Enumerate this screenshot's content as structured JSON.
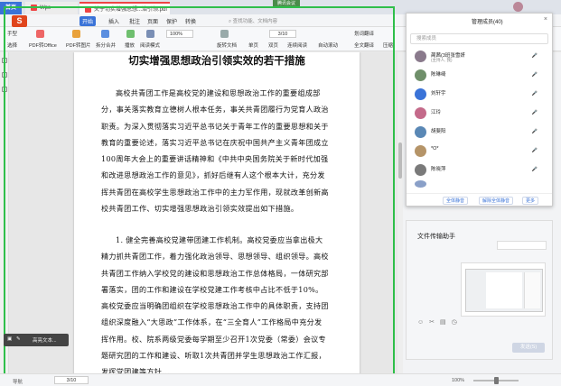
{
  "titlebar": {
    "home_tab": "首页",
    "tab1": "Wps",
    "tab2": "关于切实增强思想...治引领.pdf",
    "share_badge": "腾讯会议"
  },
  "menubar": {
    "items": [
      "开始",
      "插入",
      "批注",
      "页面",
      "保护",
      "转换"
    ],
    "search_placeholder": "查找功能、文档内容"
  },
  "toolbar": {
    "hand": "手型",
    "select": "选择",
    "pdf_to_office": "PDF转Office",
    "pdf_to_image": "PDF转图片",
    "split_merge": "拆分合并",
    "play": "播放",
    "read_mode": "阅读模式",
    "zoom": "100%",
    "rotate": "旋转文档",
    "single": "单页",
    "double": "双页",
    "continuous": "连续阅读",
    "page": "3/10",
    "auto_scroll": "自动滚动",
    "translate": "划词翻译",
    "full_translate": "全文翻译",
    "compress": "压缩"
  },
  "document": {
    "title": "切实增强思想政治引领实效的若干措施",
    "para1": "高校共青团工作是高校党的建设和思想政治工作的重要组成部分，事关落实教育立德树人根本任务，事关共青团履行为党育人政治职责。为深入贯彻落实习近平总书记关于青年工作的重要思想和关于教育的重要论述，落实习近平总书记在庆祝中国共产主义青年团成立100周年大会上的重要讲话精神和《中共中央国务院关于新时代加强和改进思想政治工作的意见》，抓好后继有人这个根本大计，充分发挥共青团在高校学生思想政治工作中的主力军作用，现就改革创新高校共青团工作、切实增强思想政治引领实效提出如下措施。",
    "para2": "1. 健全完善高校党建带团建工作机制。高校党委应当拿出极大精力抓共青团工作，着力强化政治领导、思想领导、组织领导。高校共青团工作纳入学校党的建设和思想政治工作总体格局，一体研究部署落实，团的工作和建设在学校党建工作考核中占比不低于10%。高校党委应当明确团组织在学校思想政治工作中的具体职责，支持团组织深度融入“大思政”工作体系，在“三全育人”工作格局中充分发挥作用。校、院系两级党委每学期至少召开1次党委（常委）会议专题研究团的工作和建设、听取1次共青团并学生思想政治工作汇报，发挥党团建等方针..."
  },
  "float_tool": {
    "label": "高亮文本..."
  },
  "chat_panel": {
    "title": "管理成员(40)",
    "search_placeholder": "搜索成员",
    "members": [
      {
        "name": "蔺茜(3班张雪妍",
        "sub": "(主持人, 我)",
        "color": "#8a7a8c"
      },
      {
        "name": "陈琳绮",
        "sub": "",
        "color": "#6f8f6a"
      },
      {
        "name": "刘轩宇",
        "sub": "",
        "color": "#3a73d8"
      },
      {
        "name": "江玲",
        "sub": "",
        "color": "#c46a8a"
      },
      {
        "name": "胡斐阳",
        "sub": "",
        "color": "#5a88b5"
      },
      {
        "name": "*O*",
        "sub": "",
        "color": "#b59468"
      },
      {
        "name": "陈晓萍",
        "sub": "",
        "color": "#7a7a7a"
      },
      {
        "name": "",
        "sub": "",
        "color": "#8aa0c8"
      }
    ],
    "footer": {
      "mute_all": "全体静音",
      "unmute_all": "解除全体静音",
      "more": "更多"
    }
  },
  "file_panel": {
    "title": "文件传输助手",
    "send": "发送(S)"
  },
  "statusbar": {
    "nav": "导航",
    "page": "3/10",
    "zoom": "100%"
  },
  "colors": {
    "accent": "#3a73d8",
    "share_frame": "#2fbf4a",
    "logo": "#e0451c"
  }
}
